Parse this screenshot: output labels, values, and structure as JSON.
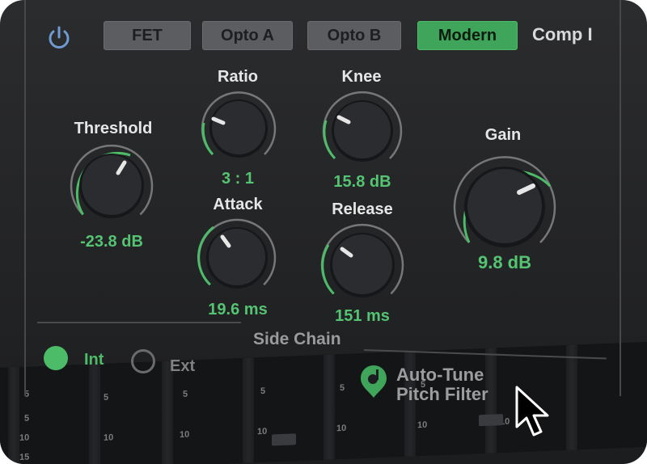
{
  "plugin": {
    "title": "Comp I",
    "modes": [
      {
        "label": "FET",
        "active": false
      },
      {
        "label": "Opto A",
        "active": false
      },
      {
        "label": "Opto B",
        "active": false
      },
      {
        "label": "Modern",
        "active": true
      }
    ],
    "power": {
      "icon": "power-icon",
      "on": true
    }
  },
  "knobs": {
    "threshold": {
      "label": "Threshold",
      "value": "-23.8 dB"
    },
    "ratio": {
      "label": "Ratio",
      "value": "3 : 1"
    },
    "knee": {
      "label": "Knee",
      "value": "15.8 dB"
    },
    "attack": {
      "label": "Attack",
      "value": "19.6 ms"
    },
    "release": {
      "label": "Release",
      "value": "151 ms"
    },
    "gain": {
      "label": "Gain",
      "value": "9.8 dB"
    }
  },
  "sidechain": {
    "title": "Side Chain",
    "int_label": "Int",
    "ext_label": "Ext",
    "selected": "Int"
  },
  "autotune": {
    "line1": "Auto-Tune",
    "line2": "Pitch Filter",
    "icon": "autotune-logo-icon"
  },
  "mixer_scale": [
    "5",
    "5",
    "10",
    "15"
  ],
  "colors": {
    "accent": "#3fa55a",
    "value_text": "#55c472",
    "panel": "#26272a"
  }
}
